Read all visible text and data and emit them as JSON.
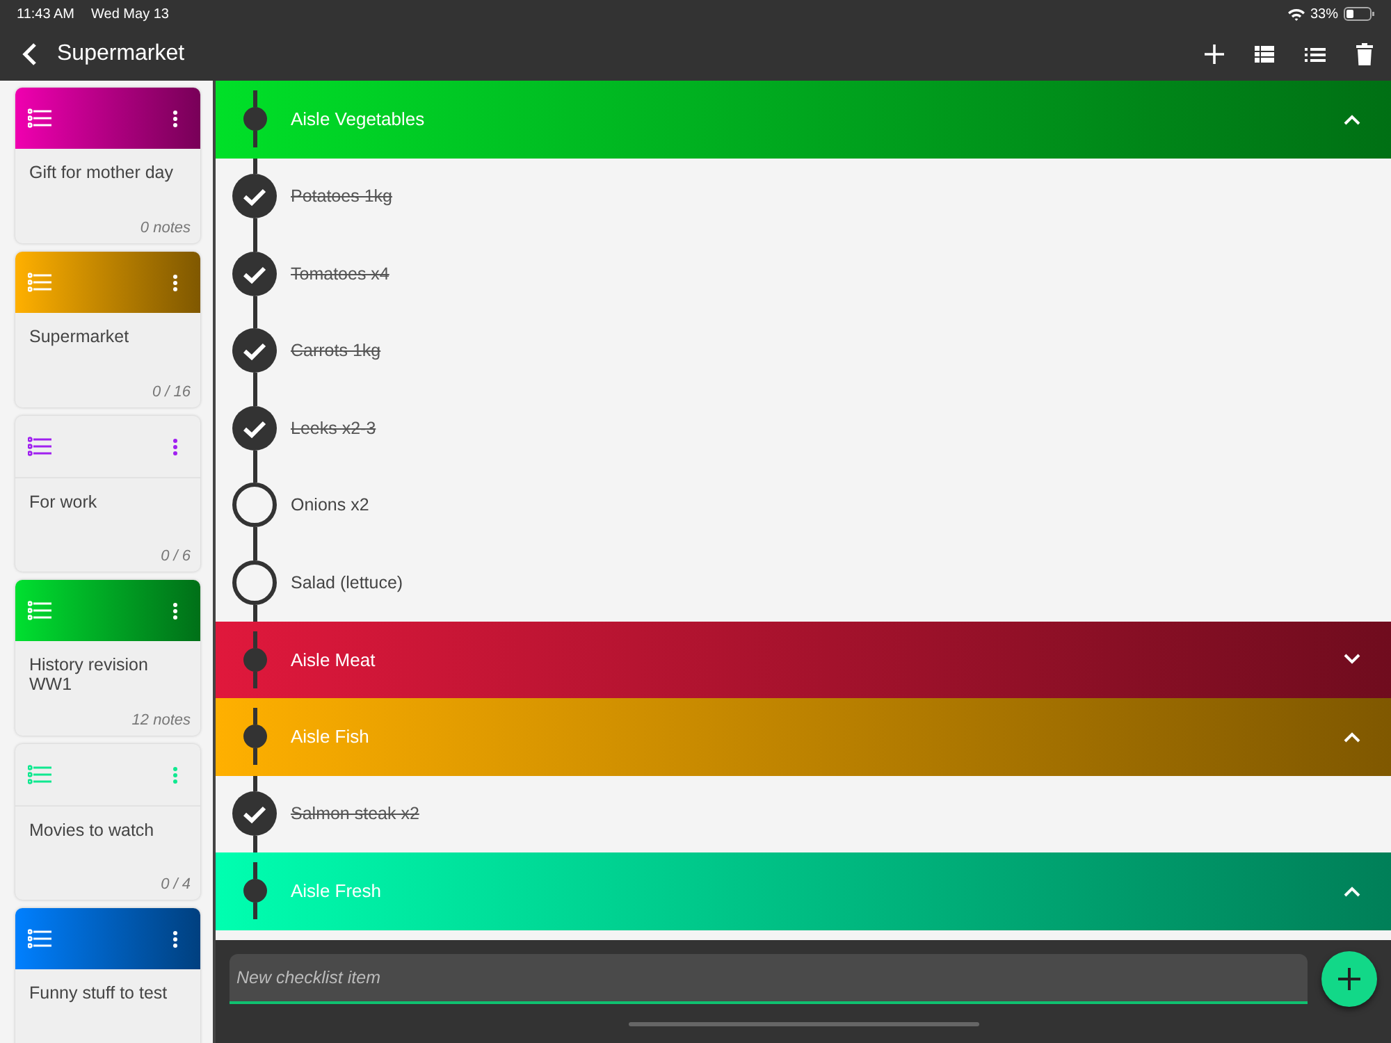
{
  "status_bar": {
    "time": "11:43 AM",
    "date": "Wed May 13",
    "battery": "33%"
  },
  "header": {
    "title": "Supermarket"
  },
  "cards": [
    {
      "title": "Gift for mother day",
      "count": "0 notes",
      "kind": "filled",
      "color": "#f000b0"
    },
    {
      "title": "Supermarket",
      "count": "0 / 16",
      "kind": "filled",
      "color": "#ffb000"
    },
    {
      "title": "For work",
      "count": "0 / 6",
      "kind": "plain",
      "color": "#a020f0"
    },
    {
      "title": "History revision WW1",
      "count": "12 notes",
      "kind": "filled",
      "color": "#00e030"
    },
    {
      "title": "Movies to watch",
      "count": "0 / 4",
      "kind": "plain",
      "color": "#10e890"
    },
    {
      "title": "Funny stuff to test",
      "kind": "filled",
      "color": "#0080ff"
    }
  ],
  "sections": [
    {
      "name": "Aisle Vegetables",
      "expanded": true,
      "color": "#00e028",
      "items": [
        {
          "text": "Potatoes 1kg",
          "checked": true
        },
        {
          "text": "Tomatoes x4",
          "checked": true
        },
        {
          "text": "Carrots 1kg",
          "checked": true
        },
        {
          "text": "Leeks x2-3",
          "checked": true
        },
        {
          "text": "Onions x2",
          "checked": false
        },
        {
          "text": "Salad (lettuce)",
          "checked": false
        }
      ]
    },
    {
      "name": "Aisle Meat",
      "expanded": false,
      "color": "#e0183c"
    },
    {
      "name": "Aisle Fish",
      "expanded": true,
      "color": "#ffb000",
      "items": [
        {
          "text": "Salmon steak x2",
          "checked": true
        }
      ]
    },
    {
      "name": "Aisle Fresh",
      "expanded": true,
      "color": "#00ffb0"
    }
  ],
  "input": {
    "placeholder": "New checklist item"
  }
}
